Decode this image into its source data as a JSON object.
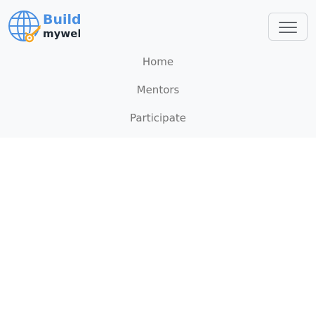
{
  "brand": {
    "line1": "Build.",
    "line2": "myweb",
    "globe_icon": "globe-icon",
    "tools_icon": "wrench-gear-icon",
    "colors": {
      "blue": "#4a90e2",
      "orange": "#f5a623",
      "dark": "#1f2933"
    }
  },
  "navbar": {
    "toggler_icon": "hamburger-menu-icon",
    "background": "#f8f9fa",
    "links": [
      {
        "label": "Home"
      },
      {
        "label": "Mentors"
      },
      {
        "label": "Participate"
      }
    ]
  }
}
